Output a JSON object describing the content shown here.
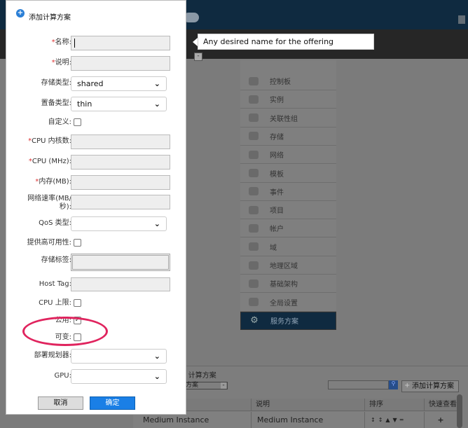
{
  "tooltip": "Any desired name for the offering",
  "nav": {
    "items": [
      {
        "label": "控制板",
        "icon": "dashboard-icon"
      },
      {
        "label": "实例",
        "icon": "cloud-icon"
      },
      {
        "label": "关联性组",
        "icon": "affinity-icon"
      },
      {
        "label": "存储",
        "icon": "storage-icon"
      },
      {
        "label": "网络",
        "icon": "network-icon"
      },
      {
        "label": "模板",
        "icon": "template-icon"
      },
      {
        "label": "事件",
        "icon": "event-icon"
      },
      {
        "label": "项目",
        "icon": "folder-icon"
      },
      {
        "label": "帐户",
        "icon": "user-icon"
      },
      {
        "label": "域",
        "icon": "domain-icon"
      },
      {
        "label": "地理区域",
        "icon": "globe-icon"
      },
      {
        "label": "基础架构",
        "icon": "infrastructure-icon"
      },
      {
        "label": "全局设置",
        "icon": "settings-icon"
      },
      {
        "label": "服务方案",
        "icon": "gear-icon",
        "active": true
      }
    ]
  },
  "panel": {
    "breadcrumb": "- 计算方案",
    "view_select": "方案",
    "add_button": "添加计算方案",
    "columns": [
      "说明",
      "排序",
      "快速查看"
    ],
    "row": {
      "name": "Medium Instance",
      "description": "Medium Instance",
      "quickview": "+"
    }
  },
  "dialog": {
    "title": "添加计算方案",
    "fields": {
      "name": {
        "label": "名称:",
        "required": true,
        "value": ""
      },
      "description": {
        "label": "说明:",
        "required": true,
        "value": ""
      },
      "storage_type": {
        "label": "存储类型:",
        "value": "shared"
      },
      "provisioning_type": {
        "label": "置备类型:",
        "value": "thin"
      },
      "custom": {
        "label": "自定义:",
        "checked": false
      },
      "cpu_cores": {
        "label": "CPU 内核数:",
        "required": true
      },
      "cpu_mhz": {
        "label": "CPU (MHz):",
        "required": true
      },
      "memory": {
        "label": "内存(MB):",
        "required": true
      },
      "network_rate": {
        "label": "网络速率(MB/秒):"
      },
      "qos_type": {
        "label": "QoS 类型:",
        "value": ""
      },
      "ha": {
        "label": "提供高可用性:",
        "checked": false
      },
      "storage_tags": {
        "label": "存储标签:"
      },
      "host_tag": {
        "label": "Host Tag:"
      },
      "cpu_cap": {
        "label": "CPU 上限:",
        "checked": false
      },
      "public": {
        "label": "公用:",
        "checked": true
      },
      "volatile": {
        "label": "可变:",
        "checked": false
      },
      "planner": {
        "label": "部署规划器:",
        "value": ""
      },
      "gpu": {
        "label": "GPU:",
        "value": ""
      }
    },
    "cancel": "取消",
    "ok": "确定"
  },
  "colors": {
    "primary_button": "#1a7fe6",
    "required": "#dd3333",
    "highlight_ellipse": "#e0245e",
    "header": "#0f2a40"
  }
}
